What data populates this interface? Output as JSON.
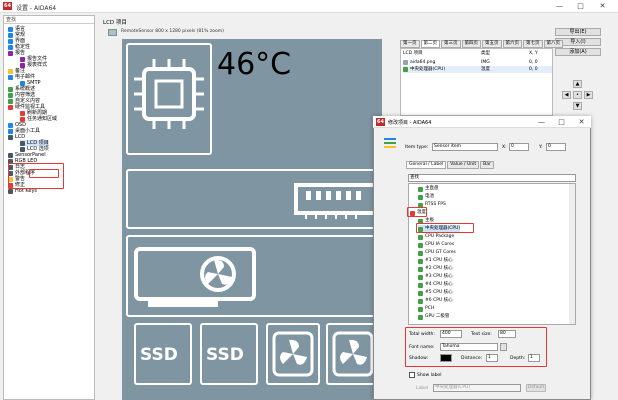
{
  "window": {
    "title": "设置 - AIDA64",
    "app_badge": "64",
    "ctrl_min": "—",
    "ctrl_max": "□",
    "ctrl_close": "✕"
  },
  "sidebar": {
    "search_placeholder": "查找",
    "items": [
      {
        "label": "语言",
        "color": "#1e88e5"
      },
      {
        "label": "常规",
        "color": "#1e88e5"
      },
      {
        "label": "界面",
        "color": "#1e88e5"
      },
      {
        "label": "稳定性",
        "color": "#1e88e5"
      },
      {
        "label": "报告",
        "color": "#8e24aa"
      },
      {
        "label": "报告文件",
        "color": "#8e24aa"
      },
      {
        "label": "报表样式",
        "color": "#8e24aa"
      },
      {
        "label": "备注",
        "color": "#fbc02d"
      },
      {
        "label": "电子邮件",
        "color": "#1e88e5"
      },
      {
        "label": "SMTP",
        "color": "#1e88e5"
      },
      {
        "label": "系统概述",
        "color": "#43a047"
      },
      {
        "label": "内容筛选",
        "color": "#43a047"
      },
      {
        "label": "自定义内容",
        "color": "#43a047"
      },
      {
        "label": "硬件监视工具",
        "color": "#e53935"
      },
      {
        "label": "刷新周期",
        "color": "#e53935"
      },
      {
        "label": "任务通知区域",
        "color": "#e53935"
      },
      {
        "label": "OSD",
        "color": "#1e88e5"
      },
      {
        "label": "桌面小工具",
        "color": "#1e88e5"
      },
      {
        "label": "LCD",
        "color": "#455a64"
      },
      {
        "label": "LCD 项目",
        "color": "#455a64"
      },
      {
        "label": "LCD 选项",
        "color": "#455a64"
      },
      {
        "label": "SensorPanel",
        "color": "#455a64"
      },
      {
        "label": "RGB LED",
        "color": "#455a64"
      },
      {
        "label": "日志",
        "color": "#455a64"
      },
      {
        "label": "外部程序",
        "color": "#455a64"
      },
      {
        "label": "警告",
        "color": "#fbc02d"
      },
      {
        "label": "修正",
        "color": "#e53935"
      },
      {
        "label": "Hot Keys",
        "color": "#455a64"
      }
    ]
  },
  "main": {
    "panel_title": "LCD 项目",
    "sub_title": "RemoteSensor 800 x 1280 pixels (81% zoom)",
    "temperature_text": "46°C",
    "ssd_label_1": "SSD",
    "ssd_label_2": "SSD"
  },
  "right": {
    "buttons": [
      "导出(E)",
      "导入(I)",
      "添加(A)"
    ],
    "tabs": [
      "第一页",
      "第二页",
      "第三页",
      "第四页",
      "第五页",
      "第六页",
      "第七页",
      "第八页"
    ],
    "list_headers": [
      "LCD 项目",
      "类型",
      "X, Y"
    ],
    "list_rows": [
      {
        "name": "aida64.png",
        "type": "IMG",
        "xy": "0, 0"
      },
      {
        "name": "中央处理器(CPU)",
        "type": "温度",
        "xy": "0, 0"
      }
    ],
    "arrows": {
      "up": "▲",
      "left": "◀",
      "center": "•",
      "right": "▶",
      "down": "▼"
    }
  },
  "dialog": {
    "title": "修改项目 - AIDA64",
    "item_type_label": "Item type:",
    "item_type_value": "Sensor item",
    "x_label": "X:",
    "x_value": "0",
    "y_label": "Y:",
    "y_value": "0",
    "tabs": [
      "General / Label",
      "Value / Unit",
      "Bar"
    ],
    "search_placeholder": "查找",
    "tree": [
      {
        "label": "主直盘",
        "color": "#43a047"
      },
      {
        "label": "电池",
        "color": "#43a047"
      },
      {
        "label": "RTSS FPS",
        "color": "#43a047"
      },
      {
        "label": "温度",
        "color": "#e53935"
      },
      {
        "label": "主板",
        "color": "#43a047"
      },
      {
        "label": "中央处理器(CPU)",
        "color": "#43a047"
      },
      {
        "label": "CPU Package",
        "color": "#43a047"
      },
      {
        "label": "CPU IA Cores",
        "color": "#43a047"
      },
      {
        "label": "CPU GT Cores",
        "color": "#43a047"
      },
      {
        "label": "#1 CPU 核心",
        "color": "#43a047"
      },
      {
        "label": "#2 CPU 核心",
        "color": "#43a047"
      },
      {
        "label": "#3 CPU 核心",
        "color": "#43a047"
      },
      {
        "label": "#4 CPU 核心",
        "color": "#43a047"
      },
      {
        "label": "#5 CPU 核心",
        "color": "#43a047"
      },
      {
        "label": "#6 CPU 核心",
        "color": "#43a047"
      },
      {
        "label": "PCH",
        "color": "#43a047"
      },
      {
        "label": "GPU 二极管",
        "color": "#43a047"
      }
    ],
    "total_width_label": "Total width:",
    "total_width_value": "400",
    "text_size_label": "Text size:",
    "text_size_value": "80",
    "font_name_label": "Font name:",
    "font_name_value": "Tahoma",
    "shadow_label": "Shadow:",
    "distance_label": "Distance:",
    "distance_value": "1",
    "depth_label": "Depth:",
    "depth_value": "1",
    "show_label": "Show label",
    "label_label": "Label",
    "label_value": "中央处理器(CPU)",
    "default_button": "Default"
  }
}
